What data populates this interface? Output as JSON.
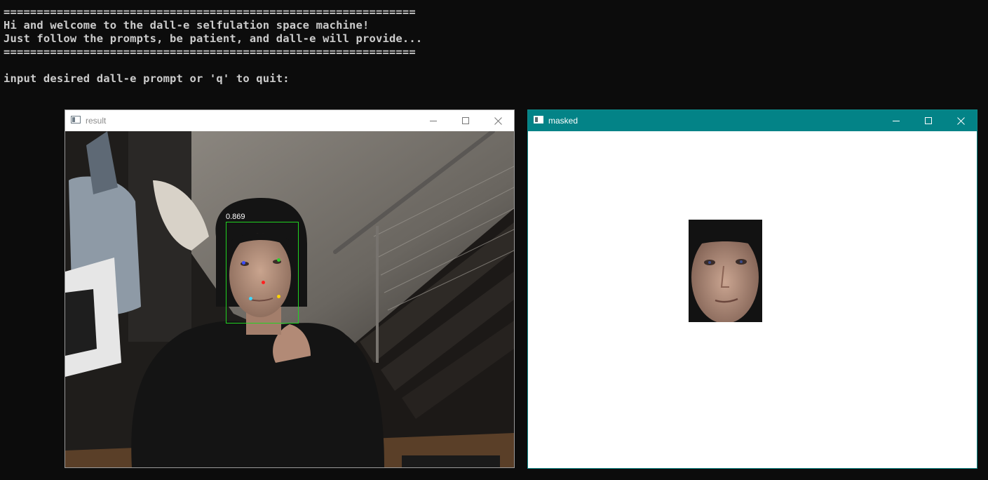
{
  "terminal": {
    "lines": [
      "==============================================================",
      "Hi and welcome to the dall-e selfulation space machine!",
      "Just follow the prompts, be patient, and dall-e will provide...",
      "==============================================================",
      "",
      "input desired dall-e prompt or 'q' to quit:"
    ]
  },
  "windows": {
    "result": {
      "title": "result",
      "detection_score": "0.869",
      "box_color": "#21d321",
      "keypoint_colors": [
        "#3a4cff",
        "#2fd12f",
        "#ff2020",
        "#3fd8ff",
        "#ffd500"
      ]
    },
    "masked": {
      "title": "masked",
      "titlebar_color": "#038387"
    }
  },
  "icons": [
    "window-app-icon",
    "minimize-icon",
    "maximize-icon",
    "close-icon"
  ]
}
